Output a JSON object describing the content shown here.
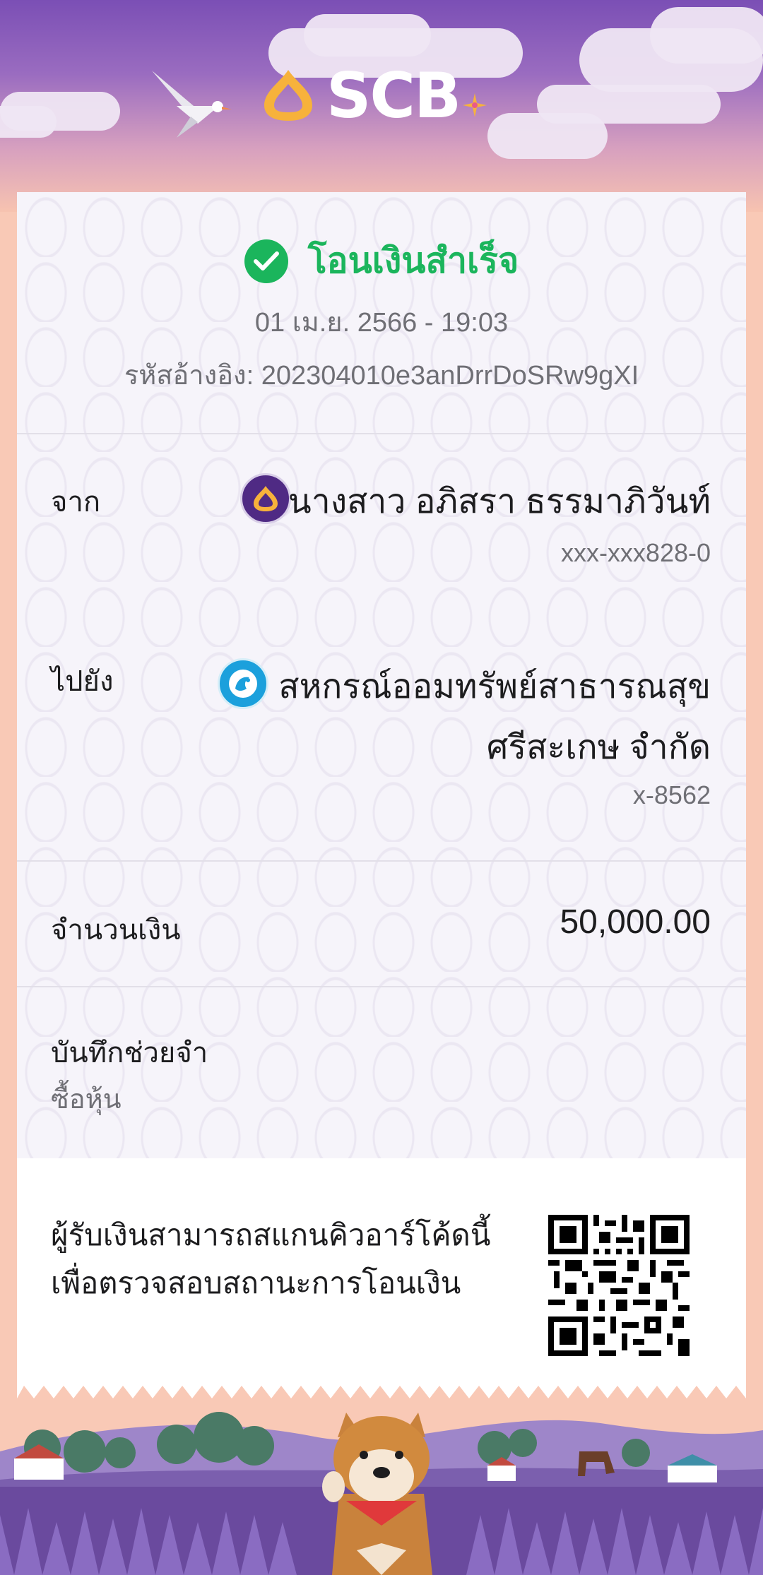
{
  "brand": {
    "name": "SCB",
    "accent": "#f5a623",
    "purple": "#4f2a84"
  },
  "status": {
    "text": "โอนเงินสำเร็จ",
    "icon": "check-circle-icon",
    "color": "#1bb55c"
  },
  "transaction": {
    "datetime": "01 เม.ย. 2566 - 19:03",
    "reference": "รหัสอ้างอิง: 202304010e3anDrrDoSRw9gXI"
  },
  "from": {
    "label": "จาก",
    "name": "นางสาว อภิสรา ธรรมาภิวันท์",
    "account": "xxx-xxx828-0",
    "bank_icon": "scb-bank-icon"
  },
  "to": {
    "label": "ไปยัง",
    "name_line1": "สหกรณ์ออมทรัพย์สาธารณสุข",
    "name_line2": "ศรีสะเกษ จำกัด",
    "account": "x-8562",
    "bank_icon": "ktb-bank-icon"
  },
  "amount": {
    "label": "จำนวนเงิน",
    "value": "50,000.00"
  },
  "note": {
    "label": "บันทึกช่วยจำ",
    "value": "ซื้อหุ้น"
  },
  "verify": {
    "line1": "ผู้รับเงินสามารถสแกนคิวอาร์โค้ดนี้",
    "line2": "เพื่อตรวจสอบสถานะการโอนเงิน"
  }
}
